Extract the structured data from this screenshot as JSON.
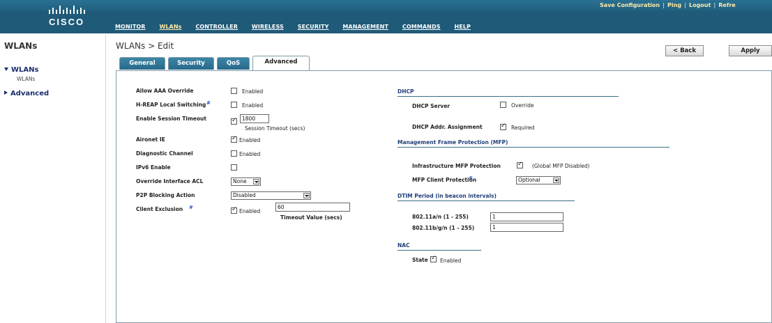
{
  "header": {
    "brand": "CISCO",
    "utility": [
      "Save Configuration",
      "Ping",
      "Logout",
      "Refre"
    ],
    "nav": [
      "MONITOR",
      "WLANs",
      "CONTROLLER",
      "WIRELESS",
      "SECURITY",
      "MANAGEMENT",
      "COMMANDS",
      "HELP"
    ],
    "active_nav": "WLANs"
  },
  "sidebar": {
    "title": "WLANs",
    "items": [
      {
        "label": "WLANs",
        "expanded": true,
        "children": [
          "WLANs"
        ]
      },
      {
        "label": "Advanced",
        "expanded": false
      }
    ]
  },
  "page": {
    "breadcrumb": "WLANs > Edit",
    "back_label": "< Back",
    "apply_label": "Apply"
  },
  "tabs": [
    "General",
    "Security",
    "QoS",
    "Advanced"
  ],
  "active_tab": "Advanced",
  "left": {
    "allow_aaa_override": {
      "label": "Allow AAA Override",
      "checked": false,
      "text": "Enabled"
    },
    "hreap_local_switching": {
      "label": "H-REAP Local Switching",
      "checked": false,
      "text": "Enabled",
      "info": "#"
    },
    "session_timeout": {
      "label": "Enable Session Timeout",
      "checked": true,
      "value": "1800",
      "caption": "Session Timeout (secs)"
    },
    "aironet_ie": {
      "label": "Aironet IE",
      "checked": true,
      "text": "Enabled"
    },
    "diagnostic_channel": {
      "label": "Diagnostic Channel",
      "checked": false,
      "text": "Enabled"
    },
    "ipv6_enable": {
      "label": "IPv6 Enable",
      "checked": false
    },
    "override_acl": {
      "label": "Override Interface ACL",
      "value": "None"
    },
    "p2p_blocking": {
      "label": "P2P Blocking Action",
      "value": "Disabled"
    },
    "client_exclusion": {
      "label": "Client Exclusion",
      "info": "#",
      "checked": true,
      "text": "Enabled",
      "value": "60",
      "caption": "Timeout Value (secs)"
    }
  },
  "right": {
    "dhcp": {
      "title": "DHCP",
      "server_label": "DHCP Server",
      "server_checked": false,
      "override_text": "Override",
      "assignment_label": "DHCP Addr. Assignment",
      "assignment_checked": true,
      "required_text": "Required"
    },
    "mfp": {
      "title": "Management Frame Protection (MFP)",
      "infra_label": "Infrastructure MFP Protection",
      "infra_checked": true,
      "global_text": "(Global MFP Disabled)",
      "client_label": "MFP Client Protection",
      "client_info": "#",
      "client_value": "Optional"
    },
    "dtim": {
      "title": "DTIM Period (in beacon intervals)",
      "a_label": "802.11a/n (1 - 255)",
      "a_value": "1",
      "bg_label": "802.11b/g/n (1 - 255)",
      "bg_value": "1"
    },
    "nac": {
      "title": "NAC",
      "state_label": "State",
      "state_checked": true,
      "enabled_text": "Enabled"
    }
  },
  "colors": {
    "header": "#1f5a78",
    "tab": "#2e7596",
    "section": "#1e3f78",
    "highlight": "#ffe9a8"
  }
}
